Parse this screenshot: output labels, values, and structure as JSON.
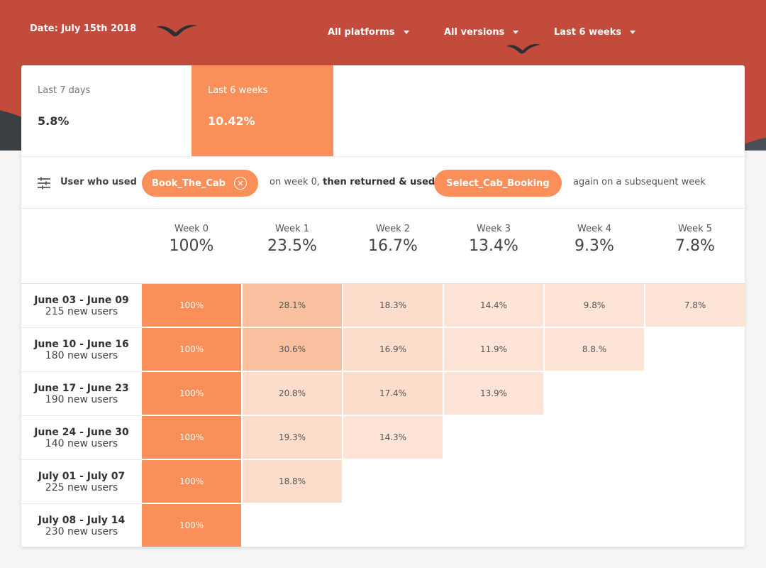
{
  "header": {
    "date_label": "Date: July 15th 2018",
    "filters": [
      "All platforms",
      "All versions",
      "Last 6 weeks"
    ]
  },
  "periods": [
    {
      "label": "Last 7 days",
      "value": "5.8%"
    },
    {
      "label": "Last 6 weeks",
      "value": "10.42%",
      "active": true
    }
  ],
  "filter_row": {
    "prefix": "User who used",
    "event_a": "Book_The_Cab",
    "middle_plain": "on week 0, ",
    "middle_bold": "then returned & used",
    "event_b": "Select_Cab_Booking",
    "suffix": "again on a subsequent week"
  },
  "weeks": [
    {
      "name": "Week 0",
      "value": "100%"
    },
    {
      "name": "Week 1",
      "value": "23.5%"
    },
    {
      "name": "Week 2",
      "value": "16.7%"
    },
    {
      "name": "Week 3",
      "value": "13.4%"
    },
    {
      "name": "Week 4",
      "value": "9.3%"
    },
    {
      "name": "Week 5",
      "value": "7.8%"
    }
  ],
  "cohorts": [
    {
      "range": "June 03 - June 09",
      "users": "215 new users",
      "cells": [
        "100%",
        "28.1%",
        "18.3%",
        "14.4%",
        "9.8%",
        "7.8%"
      ]
    },
    {
      "range": "June 10 - June 16",
      "users": "180 new users",
      "cells": [
        "100%",
        "30.6%",
        "16.9%",
        "11.9%",
        "8.8.%"
      ]
    },
    {
      "range": "June 17 - June 23",
      "users": "190 new users",
      "cells": [
        "100%",
        "20.8%",
        "17.4%",
        "13.9%"
      ]
    },
    {
      "range": "June 24 - June 30",
      "users": "140 new users",
      "cells": [
        "100%",
        "19.3%",
        "14.3%"
      ]
    },
    {
      "range": "July 01 - July 07",
      "users": "225 new users",
      "cells": [
        "100%",
        "18.8%"
      ]
    },
    {
      "range": "July 08 - July 14",
      "users": "230 new users",
      "cells": [
        "100%"
      ]
    }
  ],
  "colors": {
    "accent": "#fa8f59",
    "header_bg": "#c24b3c",
    "cell_strong": "#f9bf9e",
    "cell_mid": "#fcdccb",
    "cell_light": "#fde4d6"
  }
}
